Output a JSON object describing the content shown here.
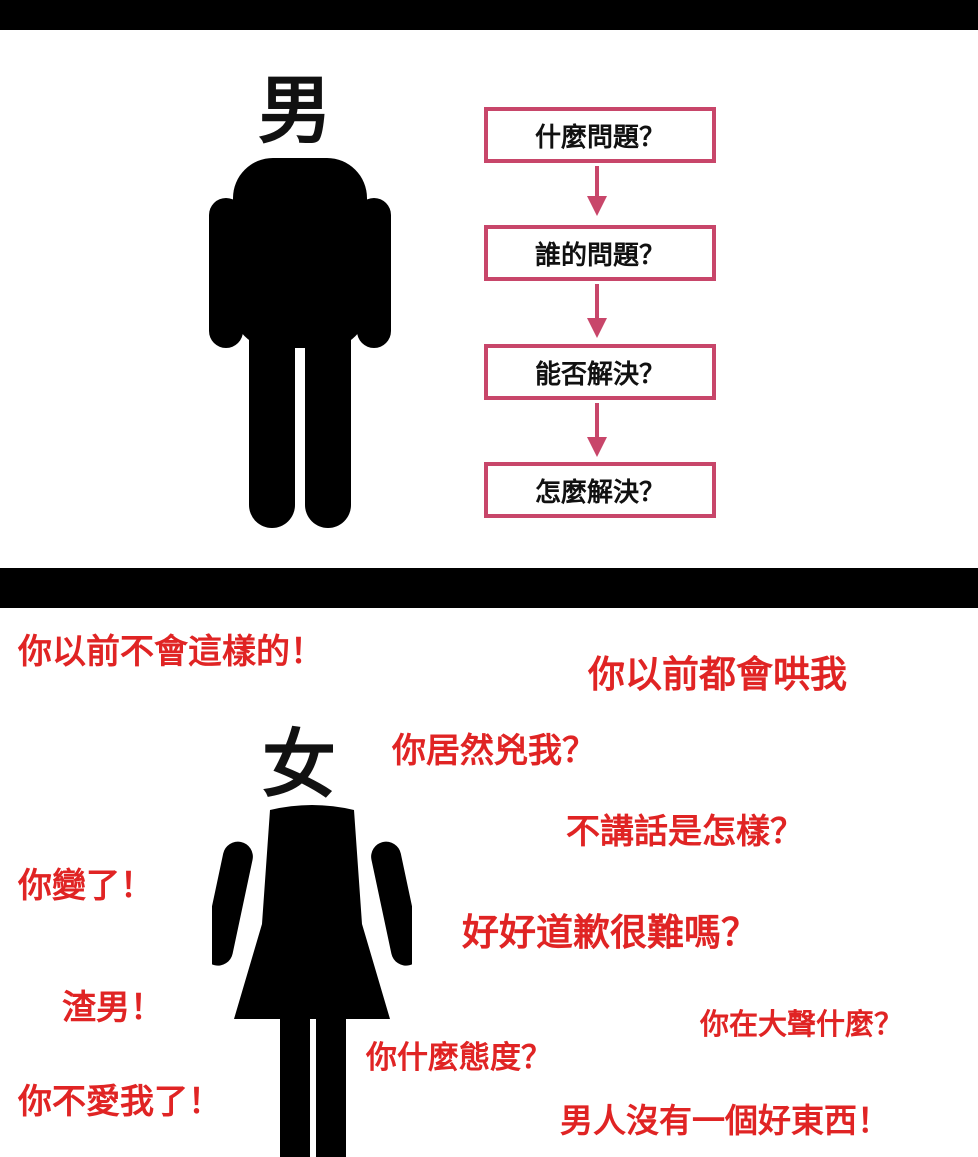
{
  "male_panel": {
    "label": "男",
    "flow_steps": [
      "什麼問題？",
      "誰的問題？",
      "能否解決？",
      "怎麼解決？"
    ]
  },
  "female_panel": {
    "label": "女",
    "quotes": [
      "你以前不會這樣的！",
      "你以前都會哄我",
      "你居然兇我？",
      "不講話是怎樣？",
      "你變了！",
      "好好道歉很難嗎？",
      "渣男！",
      "你在大聲什麼？",
      "你什麼態度？",
      "你不愛我了！",
      "男人沒有一個好東西！"
    ]
  },
  "colors": {
    "flow_border": "#c8466a",
    "quote_text": "#e02424",
    "figure": "#000000"
  }
}
